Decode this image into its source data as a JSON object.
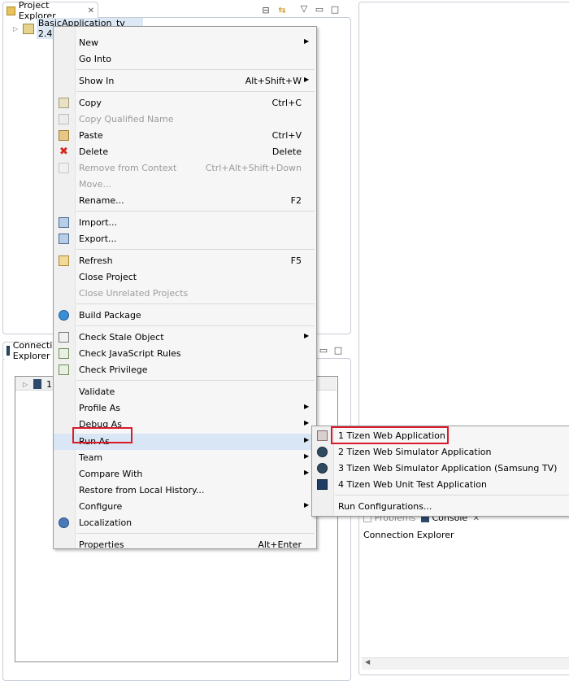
{
  "project_explorer": {
    "tab_label": "Project Explorer",
    "tree_root": "BasicApplication_tv 2.4"
  },
  "connection_explorer_tab": {
    "tab_label": "Connection Explorer"
  },
  "connection_tree": {
    "item": "1"
  },
  "bottom_right": {
    "tabs": [
      "Problems",
      "Console"
    ],
    "content": "Connection Explorer"
  },
  "context_menu": {
    "items": [
      {
        "label": "New",
        "arrow": true
      },
      {
        "label": "Go Into"
      },
      {
        "label": "Show In",
        "accel": "Alt+Shift+W",
        "arrow": true
      },
      {
        "label": "Copy",
        "accel": "Ctrl+C",
        "icon": "copy-icon"
      },
      {
        "label": "Copy Qualified Name",
        "disabled": true,
        "icon": "copy-qualified-icon"
      },
      {
        "label": "Paste",
        "accel": "Ctrl+V",
        "icon": "paste-icon"
      },
      {
        "label": "Delete",
        "accel": "Delete",
        "icon": "delete-icon"
      },
      {
        "label": "Remove from Context",
        "accel": "Ctrl+Alt+Shift+Down",
        "disabled": true,
        "icon": "remove-context-icon"
      },
      {
        "label": "Move...",
        "disabled": true
      },
      {
        "label": "Rename...",
        "accel": "F2"
      },
      {
        "label": "Import...",
        "icon": "import-icon"
      },
      {
        "label": "Export...",
        "icon": "export-icon"
      },
      {
        "label": "Refresh",
        "accel": "F5",
        "icon": "refresh-icon"
      },
      {
        "label": "Close Project"
      },
      {
        "label": "Close Unrelated Projects",
        "disabled": true
      },
      {
        "label": "Build Package",
        "icon": "build-package-icon"
      },
      {
        "label": "Check Stale Object",
        "arrow": true,
        "icon": "check-stale-icon"
      },
      {
        "label": "Check JavaScript Rules",
        "icon": "check-js-icon"
      },
      {
        "label": "Check Privilege",
        "icon": "check-privilege-icon"
      },
      {
        "label": "Validate"
      },
      {
        "label": "Profile As",
        "arrow": true
      },
      {
        "label": "Debug As",
        "arrow": true
      },
      {
        "label": "Run As",
        "arrow": true
      },
      {
        "label": "Team",
        "arrow": true
      },
      {
        "label": "Compare With",
        "arrow": true
      },
      {
        "label": "Restore from Local History..."
      },
      {
        "label": "Configure",
        "arrow": true
      },
      {
        "label": "Localization",
        "icon": "localization-icon"
      },
      {
        "label": "Properties",
        "accel": "Alt+Enter"
      }
    ]
  },
  "run_as_submenu": {
    "items": [
      {
        "label": "1 Tizen Web Application",
        "icon": "tizen-web-app-icon"
      },
      {
        "label": "2 Tizen Web Simulator Application",
        "icon": "simulator-icon"
      },
      {
        "label": "3 Tizen Web Simulator Application (Samsung TV)",
        "icon": "simulator-tv-icon"
      },
      {
        "label": "4 Tizen Web Unit Test Application",
        "icon": "unit-test-icon"
      },
      {
        "label": "Run Configurations..."
      }
    ]
  }
}
